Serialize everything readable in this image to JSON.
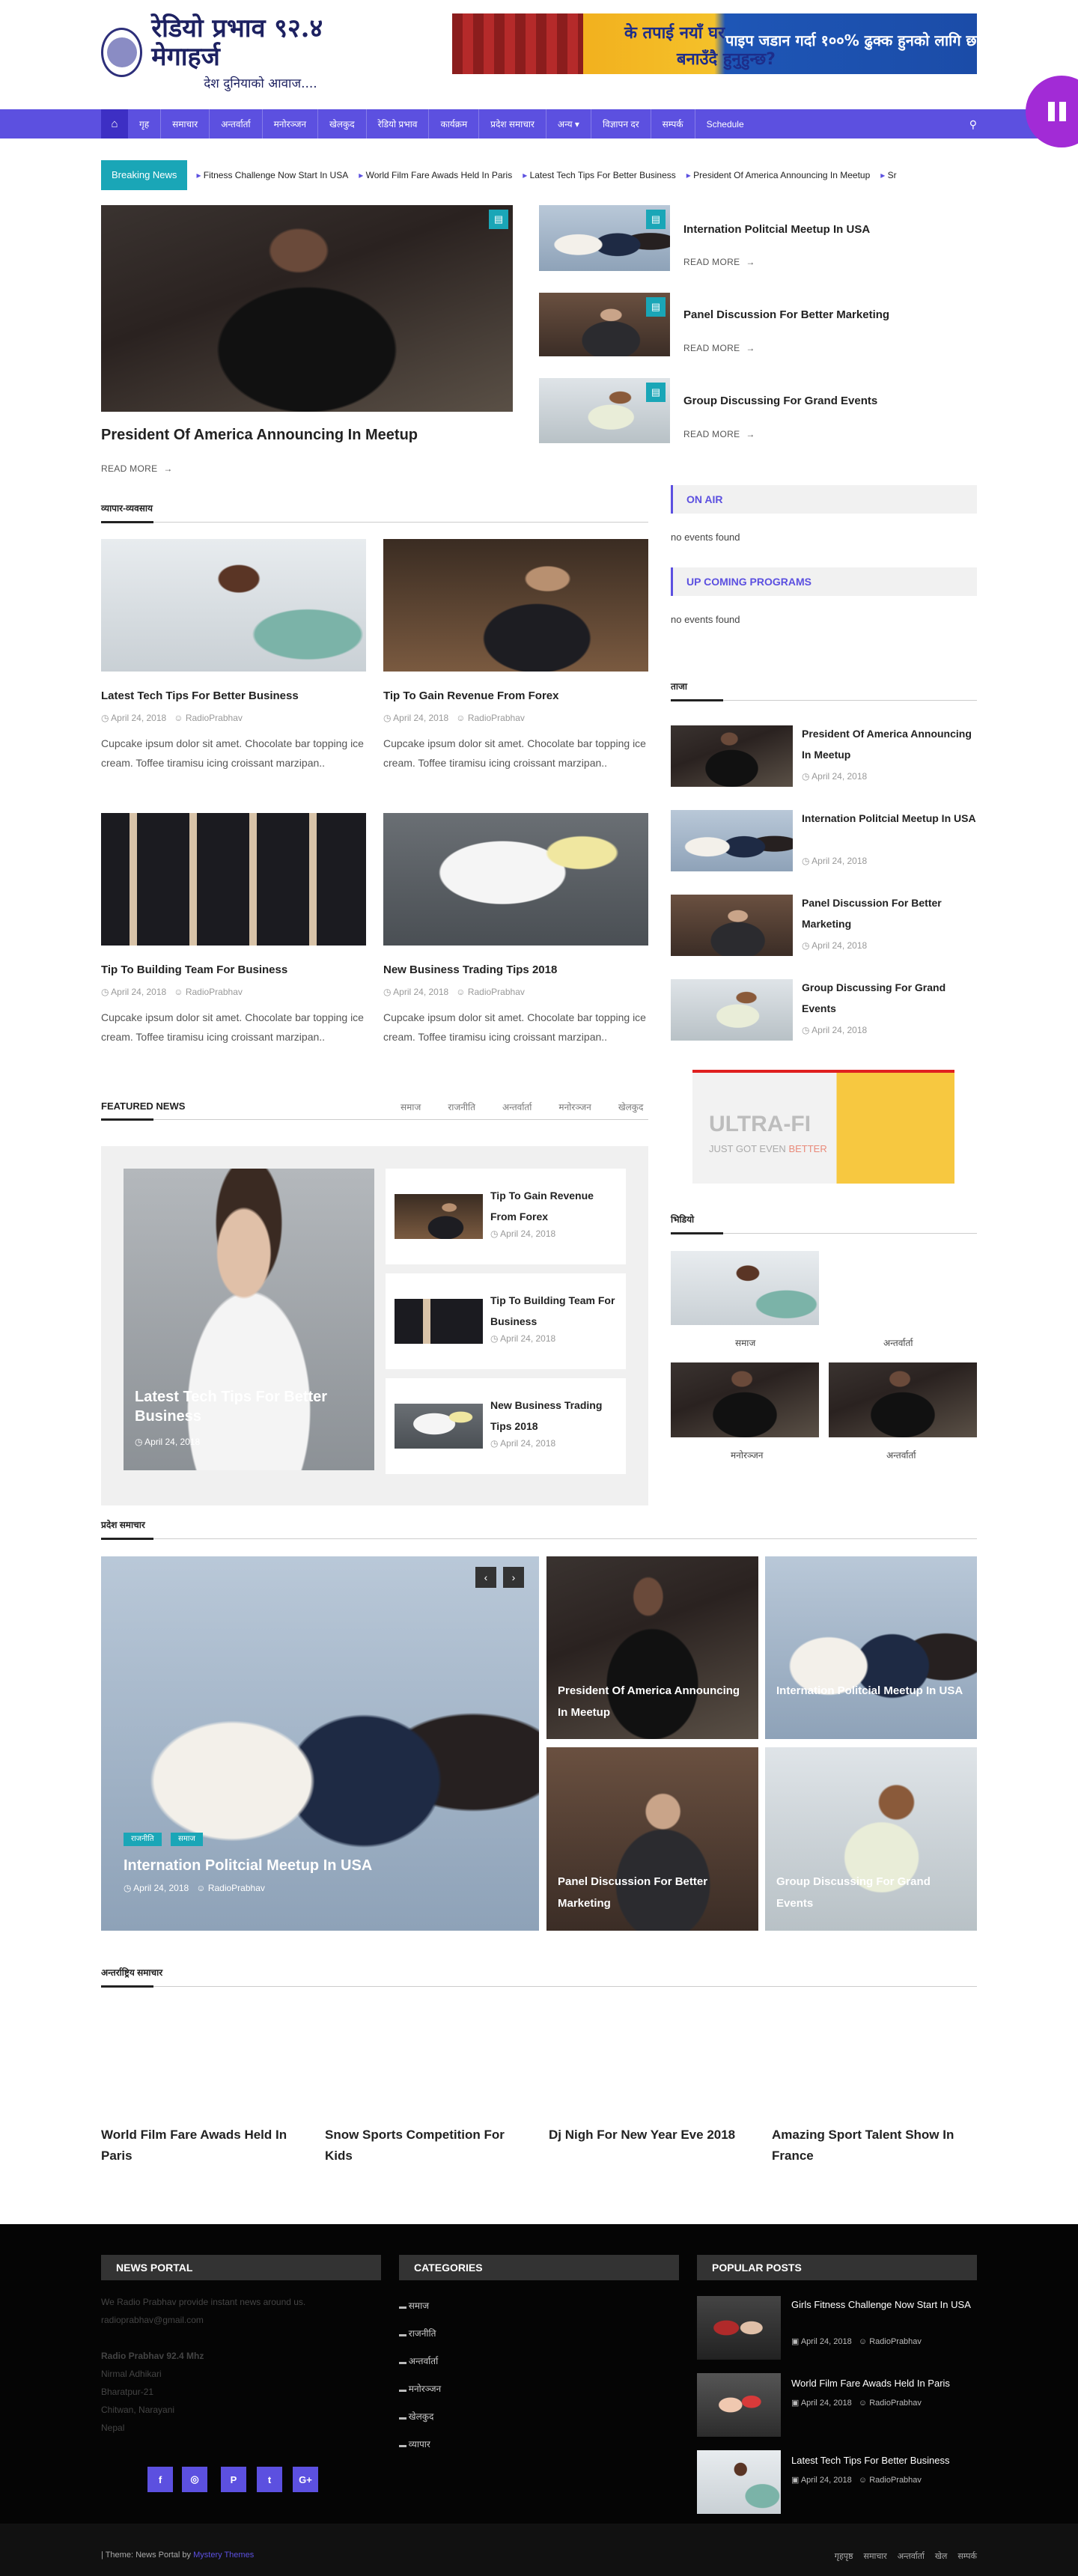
{
  "header": {
    "logo_line1": "रेडियो प्रभाव ९२.४ मेगाहर्ज",
    "logo_line2": "देश दुनियाको आवाज....",
    "ad_text1": "के तपाई नयाँ घर",
    "ad_text2": "बनाउँदै हुनुहुन्छ?",
    "ad_text3": "पाइप जडान गर्दा १००% ढुक्क हुनको लागि छ"
  },
  "nav": {
    "home_icon": "home-icon",
    "items": [
      "गृह",
      "समाचार",
      "अन्तर्वार्ता",
      "मनोरञ्जन",
      "खेलकुद",
      "रेडियो प्रभाव",
      "कार्यक्रम",
      "प्रदेश समाचार",
      "अन्य ▾",
      "विज्ञापन दर",
      "सम्पर्क",
      "Schedule"
    ],
    "search_icon": "search-icon"
  },
  "breaking": {
    "label": "Breaking News",
    "items": [
      "Fitness Challenge Now Start In USA",
      "World Film Fare Awads Held In Paris",
      "Latest Tech Tips For Better Business",
      "President Of America Announcing In Meetup",
      "Sr"
    ]
  },
  "hero": {
    "title": "President Of America Announcing In Meetup",
    "read_more": "READ MORE"
  },
  "side_posts": [
    {
      "title": "Internation Politcial Meetup In USA",
      "read_more": "READ MORE"
    },
    {
      "title": "Panel Discussion For Better Marketing",
      "read_more": "READ MORE"
    },
    {
      "title": "Group Discussing For Grand Events",
      "read_more": "READ MORE"
    }
  ],
  "section_business": {
    "title": "व्यापार-व्यवसाय",
    "posts": [
      {
        "title": "Latest Tech Tips For Better Business",
        "date": "April 24, 2018",
        "author": "RadioPrabhav",
        "excerpt": "Cupcake ipsum dolor sit amet. Chocolate bar topping ice cream. Toffee tiramisu icing croissant marzipan.."
      },
      {
        "title": "Tip To Gain Revenue From Forex",
        "date": "April 24, 2018",
        "author": "RadioPrabhav",
        "excerpt": "Cupcake ipsum dolor sit amet. Chocolate bar topping ice cream. Toffee tiramisu icing croissant marzipan.."
      },
      {
        "title": "Tip To Building Team For Business",
        "date": "April 24, 2018",
        "author": "RadioPrabhav",
        "excerpt": "Cupcake ipsum dolor sit amet. Chocolate bar topping ice cream. Toffee tiramisu icing croissant marzipan.."
      },
      {
        "title": "New Business Trading Tips 2018",
        "date": "April 24, 2018",
        "author": "RadioPrabhav",
        "excerpt": "Cupcake ipsum dolor sit amet. Chocolate bar topping ice cream. Toffee tiramisu icing croissant marzipan.."
      }
    ]
  },
  "on_air": {
    "title": "ON AIR",
    "empty": "no events found"
  },
  "upcoming": {
    "title": "UP COMING PROGRAMS",
    "empty": "no events found"
  },
  "sidebar_latest": {
    "title": "ताजा",
    "posts": [
      {
        "title": "President Of America Announcing In Meetup",
        "date": "April 24, 2018"
      },
      {
        "title": "Internation Politcial Meetup In USA",
        "date": "April 24, 2018"
      },
      {
        "title": "Panel Discussion For Better Marketing",
        "date": "April 24, 2018"
      },
      {
        "title": "Group Discussing For Grand Events",
        "date": "April 24, 2018"
      }
    ]
  },
  "ultra_ad": {
    "brand": "ULTRA-FI",
    "tagline_a": "JUST GOT EVEN",
    "tagline_b": "BETTER"
  },
  "sidebar_gallery": {
    "title": "भिडियो",
    "captions": [
      "समाज",
      "अन्तर्वार्ता",
      "मनोरञ्जन",
      "अन्तर्वार्ता"
    ]
  },
  "featured": {
    "title": "FEATURED NEWS",
    "tabs": [
      "समाज",
      "राजनीति",
      "अन्तर्वार्ता",
      "मनोरञ्जन",
      "खेलकुद"
    ],
    "main": {
      "title": "Latest Tech Tips For Better Business",
      "date": "April 24, 2018"
    },
    "list": [
      {
        "title": "Tip To Gain Revenue From Forex",
        "date": "April 24, 2018"
      },
      {
        "title": "Tip To Building Team For Business",
        "date": "April 24, 2018"
      },
      {
        "title": "New Business Trading Tips 2018",
        "date": "April 24, 2018"
      }
    ]
  },
  "gallery_section": {
    "title": "प्रदेश समाचार",
    "main": {
      "title": "Internation Politcial Meetup In USA",
      "date": "April 24, 2018",
      "author": "RadioPrabhav",
      "tags": [
        "राजनीति",
        "समाज"
      ]
    },
    "grid": [
      "President Of America Announcing In Meetup",
      "Internation Politcial Meetup In USA",
      "Panel Discussion For Better Marketing",
      "Group Discussing For Grand Events"
    ]
  },
  "sports_section": {
    "title": "अन्तर्राष्ट्रिय समाचार",
    "posts": [
      "World Film Fare Awads Held In Paris",
      "Snow Sports Competition For Kids",
      "Dj Nigh For New Year Eve 2018",
      "Amazing Sport Talent Show In France"
    ]
  },
  "footer": {
    "news_portal": {
      "title": "NEWS PORTAL",
      "desc": "We Radio Prabhav provide instant news around us.",
      "email": "radioprabhav@gmail.com",
      "company": "Radio Prabhav 92.4 Mhz",
      "contact": "Nirmal Adhikari",
      "address1": "Bharatpur-21",
      "address2": "Chitwan, Narayani",
      "country": "Nepal",
      "social": [
        "f",
        "◎",
        "P",
        "t",
        "G+"
      ]
    },
    "categories": {
      "title": "CATEGORIES",
      "items": [
        "समाज",
        "राजनीति",
        "अन्तर्वार्ता",
        "मनोरञ्जन",
        "खेलकुद",
        "व्यापार"
      ]
    },
    "popular": {
      "title": "POPULAR POSTS",
      "posts": [
        {
          "title": "Girls Fitness Challenge Now Start In USA",
          "date": "April 24, 2018",
          "author": "RadioPrabhav"
        },
        {
          "title": "World Film Fare Awads Held In Paris",
          "date": "April 24, 2018",
          "author": "RadioPrabhav"
        },
        {
          "title": "Latest Tech Tips For Better Business",
          "date": "April 24, 2018",
          "author": "RadioPrabhav"
        }
      ]
    }
  },
  "bottom": {
    "theme_prefix": "| Theme: News Portal by",
    "theme_link": "Mystery Themes",
    "links": [
      "गृहपृष्ठ",
      "समाचार",
      "अन्तर्वार्ता",
      "खेल",
      "सम्पर्क"
    ]
  },
  "colors": {
    "accent": "#5c50e0",
    "teal": "#1aa6b7",
    "pause": "#a22bd6"
  }
}
